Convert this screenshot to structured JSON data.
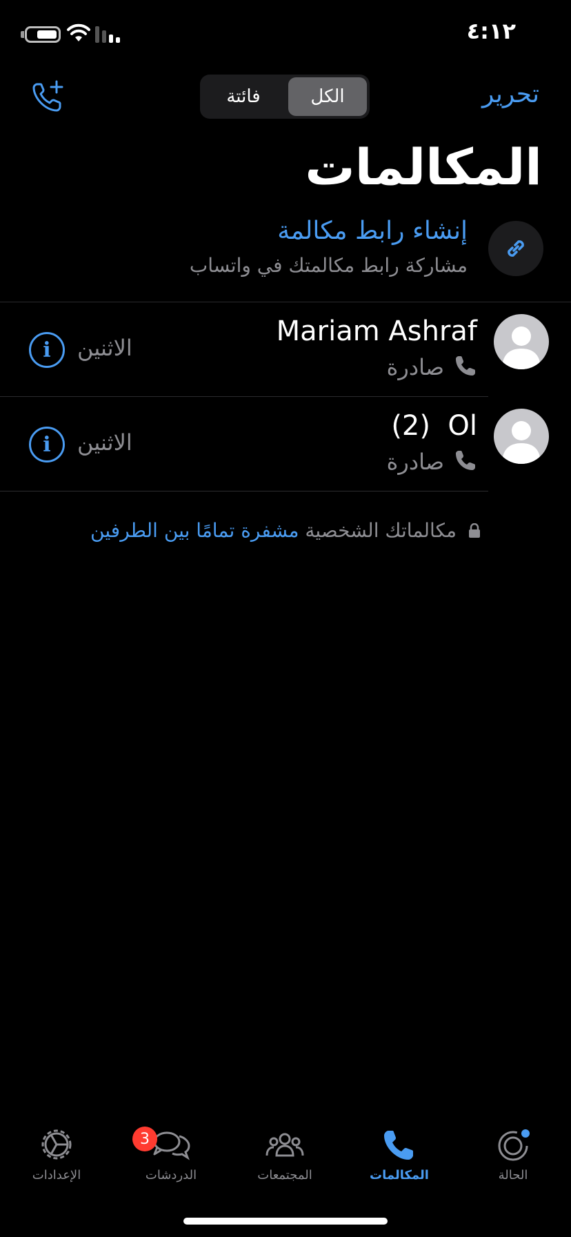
{
  "status_bar": {
    "time": "٤:١٢"
  },
  "header": {
    "edit_label": "تحرير",
    "segments": {
      "all": "الكل",
      "missed": "فائتة"
    },
    "title": "المكالمات"
  },
  "call_link": {
    "title": "إنشاء رابط مكالمة",
    "subtitle": "مشاركة رابط مكالمتك في واتساب"
  },
  "calls": [
    {
      "name": "Mariam Ashraf",
      "direction": "صادرة",
      "day": "الاثنين"
    },
    {
      "name": "(2)  Ol",
      "direction": "صادرة",
      "day": "الاثنين"
    }
  ],
  "encryption_note": {
    "prefix": "مكالماتك الشخصية",
    "highlight": "مشفرة تمامًا بين الطرفين"
  },
  "tabs": {
    "status": "الحالة",
    "calls": "المكالمات",
    "communities": "المجتمعات",
    "chats": "الدردشات",
    "settings": "الإعدادات"
  },
  "chats_badge": "3",
  "colors": {
    "accent": "#4a9cf2",
    "badge": "#ff3b30",
    "secondary_text": "#8e8e93"
  }
}
